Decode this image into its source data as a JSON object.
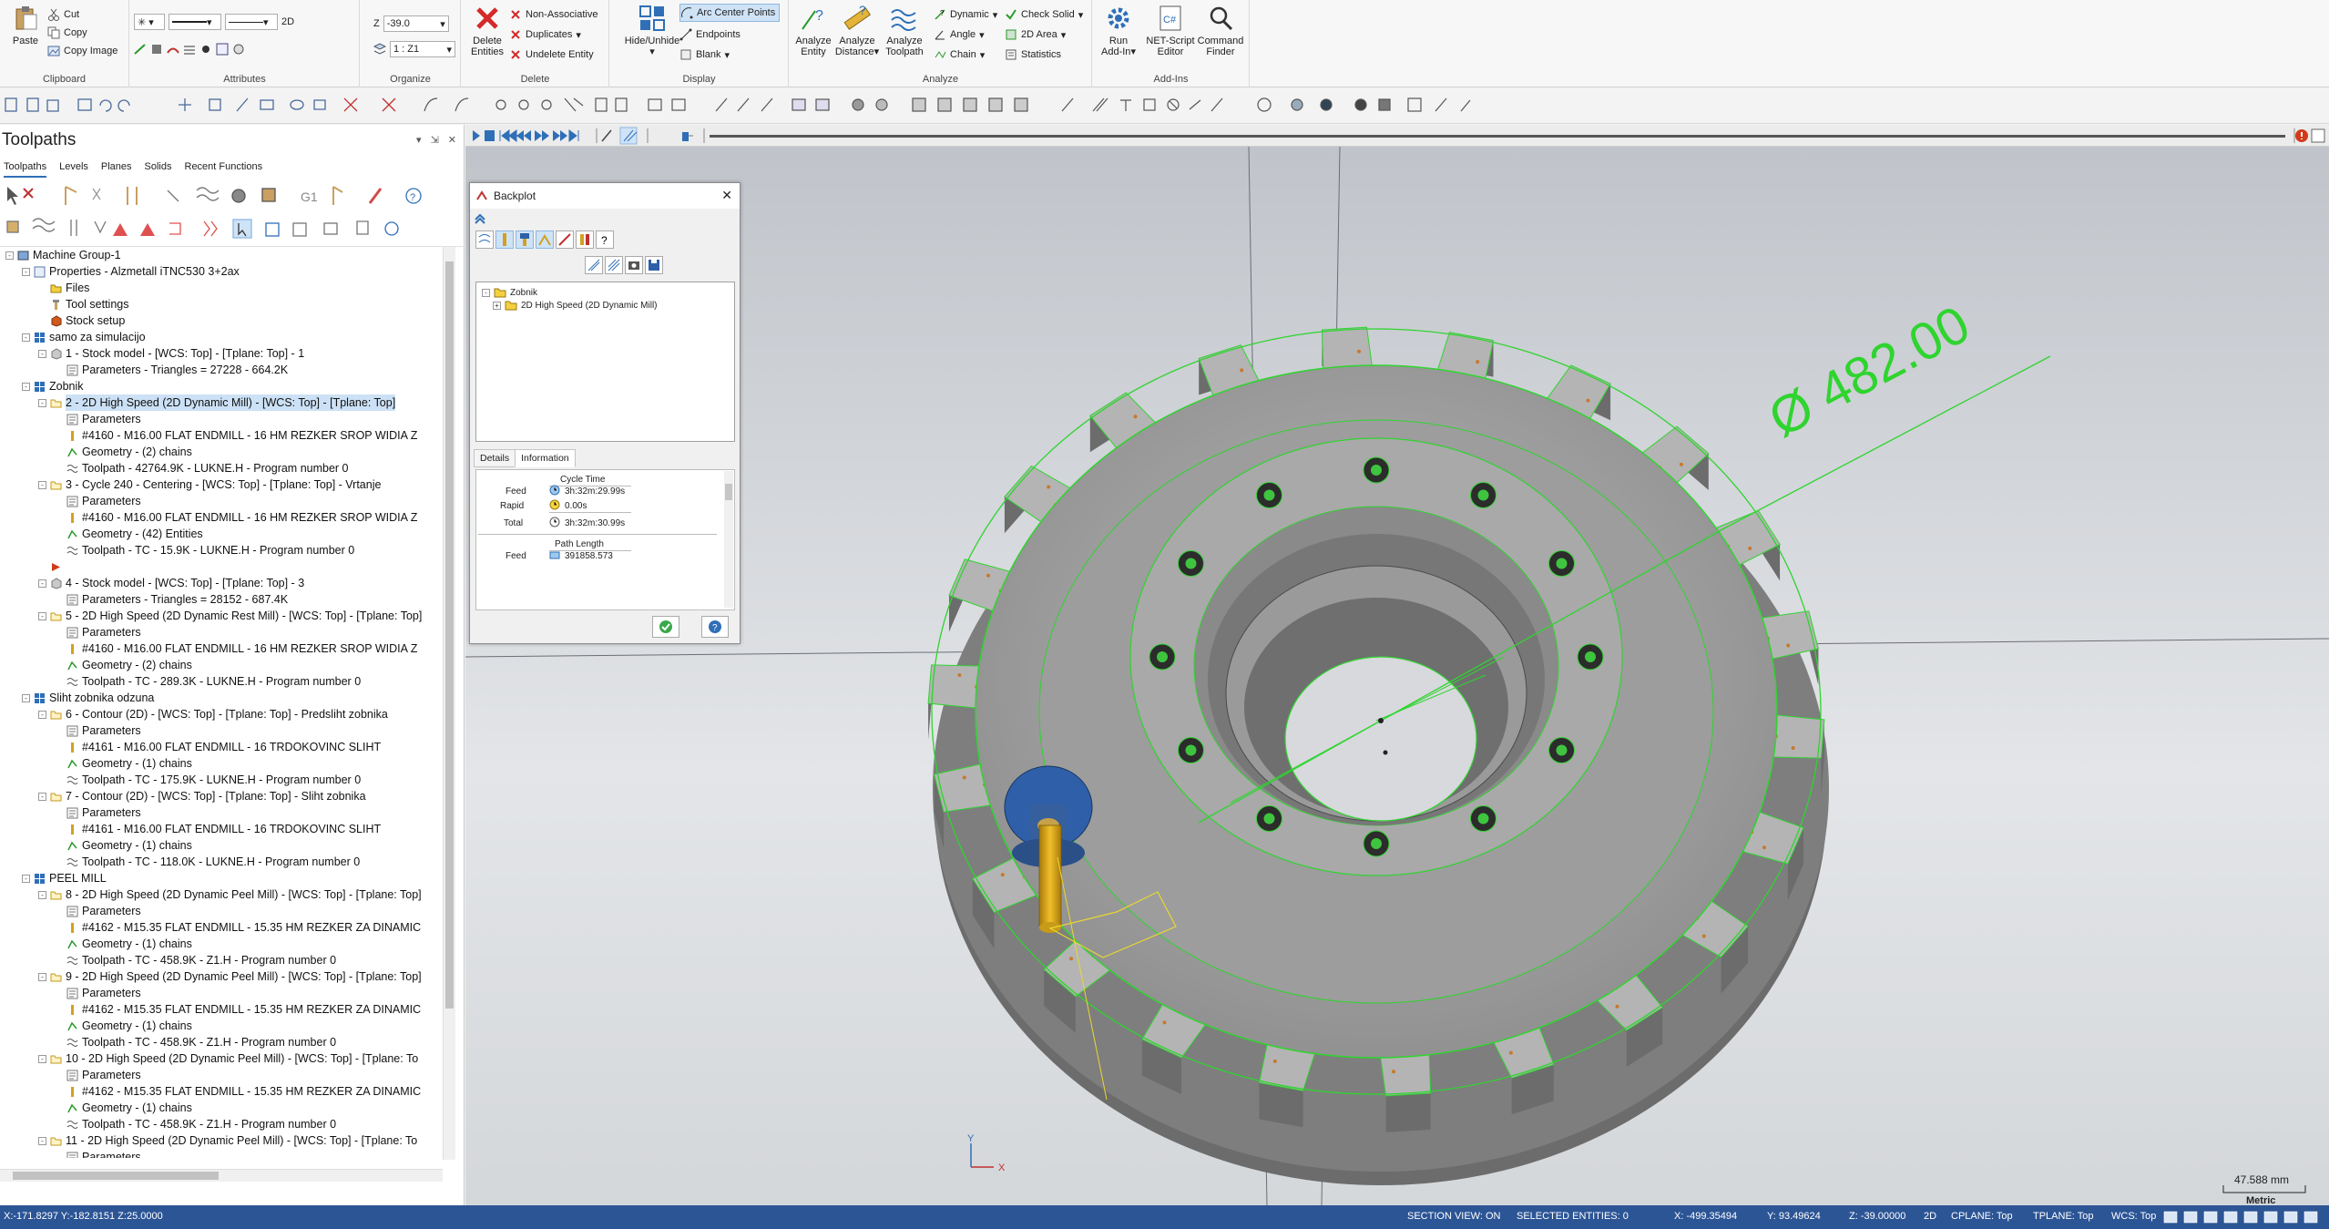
{
  "ribbon": {
    "clipboard": {
      "paste": "Paste",
      "cut": "Cut",
      "copy": "Copy",
      "copy_image": "Copy Image",
      "label": "Clipboard"
    },
    "attributes": {
      "mode": "2D",
      "label": "Attributes"
    },
    "organize": {
      "z_label": "Z",
      "z_value": "-39.0",
      "level_value": "1 : Z1",
      "label": "Organize"
    },
    "delete": {
      "delete_entities": "Delete\nEntities",
      "non_associative": "Non-Associative",
      "duplicates": "Duplicates",
      "undelete_entity": "Undelete Entity",
      "label": "Delete"
    },
    "display": {
      "hide_unhide": "Hide/Unhide",
      "arc_center_points": "Arc Center Points",
      "endpoints": "Endpoints",
      "blank": "Blank",
      "label": "Display"
    },
    "analyze": {
      "analyze_entity": "Analyze\nEntity",
      "analyze_distance": "Analyze\nDistance",
      "analyze_toolpath": "Analyze\nToolpath",
      "dynamic": "Dynamic",
      "angle": "Angle",
      "chain": "Chain",
      "check_solid": "Check Solid",
      "area_2d": "2D Area",
      "statistics": "Statistics",
      "label": "Analyze"
    },
    "addins": {
      "run_addin": "Run\nAdd-In",
      "net_script_editor": "NET-Script\nEditor",
      "command_finder": "Command\nFinder",
      "label": "Add-Ins"
    }
  },
  "left_panel": {
    "title": "Toolpaths",
    "controls": [
      "▾",
      "⇲",
      "✕"
    ],
    "tabs": [
      "Toolpaths",
      "Levels",
      "Planes",
      "Solids",
      "Recent Functions"
    ],
    "tree": [
      {
        "text": "Machine Group-1",
        "indent": 0,
        "icon": "machine-icon",
        "exp": "-"
      },
      {
        "text": "Properties - Alzmetall  iTNC530 3+2ax",
        "indent": 1,
        "icon": "properties-icon",
        "exp": "-"
      },
      {
        "text": "Files",
        "indent": 2,
        "icon": "folder-icon"
      },
      {
        "text": "Tool settings",
        "indent": 2,
        "icon": "tool-settings-icon"
      },
      {
        "text": "Stock setup",
        "indent": 2,
        "icon": "stock-icon"
      },
      {
        "text": "samo za simulacijo",
        "indent": 1,
        "icon": "group-icon",
        "exp": "-"
      },
      {
        "text": "1 - Stock model - [WCS: Top] - [Tplane: Top] - 1",
        "indent": 2,
        "icon": "stock-model-icon",
        "exp": "-"
      },
      {
        "text": "Parameters - Triangles = 27228 - 664.2K",
        "indent": 3,
        "icon": "parameters-icon"
      },
      {
        "text": "Zobnik",
        "indent": 1,
        "icon": "group-icon",
        "exp": "-"
      },
      {
        "text": "2 - 2D High Speed (2D Dynamic Mill) - [WCS: Top] - [Tplane: Top]",
        "indent": 2,
        "icon": "operation-folder-icon",
        "exp": "-",
        "selected": true
      },
      {
        "text": "Parameters",
        "indent": 3,
        "icon": "parameters-icon"
      },
      {
        "text": "#4160 - M16.00 FLAT ENDMILL - 16 HM REZKER SROP WIDIA Z",
        "indent": 3,
        "icon": "tool-icon"
      },
      {
        "text": "Geometry - (2) chains",
        "indent": 3,
        "icon": "geometry-icon"
      },
      {
        "text": "Toolpath - 42764.9K - LUKNE.H - Program number 0",
        "indent": 3,
        "icon": "toolpath-icon"
      },
      {
        "text": "3 - Cycle 240 - Centering - [WCS: Top] - [Tplane: Top] - Vrtanje",
        "indent": 2,
        "icon": "operation-folder-icon",
        "exp": "-"
      },
      {
        "text": "Parameters",
        "indent": 3,
        "icon": "parameters-icon"
      },
      {
        "text": "#4160 - M16.00 FLAT ENDMILL - 16 HM REZKER SROP WIDIA Z",
        "indent": 3,
        "icon": "tool-icon"
      },
      {
        "text": "Geometry - (42) Entities",
        "indent": 3,
        "icon": "geometry-icon"
      },
      {
        "text": "Toolpath - TC - 15.9K - LUKNE.H - Program number 0",
        "indent": 3,
        "icon": "toolpath-icon"
      },
      {
        "text": "",
        "indent": 2,
        "icon": "insert-arrow-icon"
      },
      {
        "text": "4 - Stock model - [WCS: Top] - [Tplane: Top] - 3",
        "indent": 2,
        "icon": "stock-model-icon",
        "exp": "-"
      },
      {
        "text": "Parameters - Triangles = 28152 - 687.4K",
        "indent": 3,
        "icon": "parameters-icon"
      },
      {
        "text": "5 - 2D High Speed (2D Dynamic Rest Mill) - [WCS: Top] - [Tplane: Top]",
        "indent": 2,
        "icon": "operation-folder-icon",
        "exp": "-"
      },
      {
        "text": "Parameters",
        "indent": 3,
        "icon": "parameters-icon"
      },
      {
        "text": "#4160 - M16.00 FLAT ENDMILL - 16 HM REZKER SROP WIDIA Z",
        "indent": 3,
        "icon": "tool-icon"
      },
      {
        "text": "Geometry - (2) chains",
        "indent": 3,
        "icon": "geometry-icon"
      },
      {
        "text": "Toolpath - TC - 289.3K - LUKNE.H - Program number 0",
        "indent": 3,
        "icon": "toolpath-icon"
      },
      {
        "text": "Sliht zobnika odzuna",
        "indent": 1,
        "icon": "group-icon",
        "exp": "-"
      },
      {
        "text": "6 - Contour (2D) - [WCS: Top] - [Tplane: Top] - Predsliht zobnika",
        "indent": 2,
        "icon": "operation-folder-icon",
        "exp": "-"
      },
      {
        "text": "Parameters",
        "indent": 3,
        "icon": "parameters-icon"
      },
      {
        "text": "#4161 - M16.00 FLAT ENDMILL - 16 TRDOKOVINC SLIHT",
        "indent": 3,
        "icon": "tool-icon"
      },
      {
        "text": "Geometry - (1) chains",
        "indent": 3,
        "icon": "geometry-icon"
      },
      {
        "text": "Toolpath - TC - 175.9K - LUKNE.H - Program number 0",
        "indent": 3,
        "icon": "toolpath-icon"
      },
      {
        "text": "7 - Contour (2D) - [WCS: Top] - [Tplane: Top] - Sliht zobnika",
        "indent": 2,
        "icon": "operation-folder-icon",
        "exp": "-"
      },
      {
        "text": "Parameters",
        "indent": 3,
        "icon": "parameters-icon"
      },
      {
        "text": "#4161 - M16.00 FLAT ENDMILL - 16 TRDOKOVINC SLIHT",
        "indent": 3,
        "icon": "tool-icon"
      },
      {
        "text": "Geometry - (1) chains",
        "indent": 3,
        "icon": "geometry-icon"
      },
      {
        "text": "Toolpath - TC - 118.0K - LUKNE.H - Program number 0",
        "indent": 3,
        "icon": "toolpath-icon"
      },
      {
        "text": "PEEL MILL",
        "indent": 1,
        "icon": "group-icon",
        "exp": "-"
      },
      {
        "text": "8 - 2D High Speed (2D Dynamic Peel Mill) - [WCS: Top] - [Tplane: Top]",
        "indent": 2,
        "icon": "operation-folder-icon",
        "exp": "-"
      },
      {
        "text": "Parameters",
        "indent": 3,
        "icon": "parameters-icon"
      },
      {
        "text": "#4162 - M15.35 FLAT ENDMILL - 15.35 HM REZKER ZA DINAMIC",
        "indent": 3,
        "icon": "tool-icon"
      },
      {
        "text": "Geometry - (1) chains",
        "indent": 3,
        "icon": "geometry-icon"
      },
      {
        "text": "Toolpath - TC - 458.9K - Z1.H - Program number 0",
        "indent": 3,
        "icon": "toolpath-icon"
      },
      {
        "text": "9 - 2D High Speed (2D Dynamic Peel Mill) - [WCS: Top] - [Tplane: Top]",
        "indent": 2,
        "icon": "operation-folder-icon",
        "exp": "-"
      },
      {
        "text": "Parameters",
        "indent": 3,
        "icon": "parameters-icon"
      },
      {
        "text": "#4162 - M15.35 FLAT ENDMILL - 15.35 HM REZKER ZA DINAMIC",
        "indent": 3,
        "icon": "tool-icon"
      },
      {
        "text": "Geometry - (1) chains",
        "indent": 3,
        "icon": "geometry-icon"
      },
      {
        "text": "Toolpath - TC - 458.9K - Z1.H - Program number 0",
        "indent": 3,
        "icon": "toolpath-icon"
      },
      {
        "text": "10 - 2D High Speed (2D Dynamic Peel Mill) - [WCS: Top] - [Tplane: To",
        "indent": 2,
        "icon": "operation-folder-icon",
        "exp": "-"
      },
      {
        "text": "Parameters",
        "indent": 3,
        "icon": "parameters-icon"
      },
      {
        "text": "#4162 - M15.35 FLAT ENDMILL - 15.35 HM REZKER ZA DINAMIC",
        "indent": 3,
        "icon": "tool-icon"
      },
      {
        "text": "Geometry - (1) chains",
        "indent": 3,
        "icon": "geometry-icon"
      },
      {
        "text": "Toolpath - TC - 458.9K - Z1.H - Program number 0",
        "indent": 3,
        "icon": "toolpath-icon"
      },
      {
        "text": "11 - 2D High Speed (2D Dynamic Peel Mill) - [WCS: Top] - [Tplane: To",
        "indent": 2,
        "icon": "operation-folder-icon",
        "exp": "-"
      },
      {
        "text": "Parameters",
        "indent": 3,
        "icon": "parameters-icon"
      }
    ]
  },
  "backplot": {
    "title": "Backplot",
    "tree_root": "Zobnik",
    "tree_child": "2D High Speed (2D Dynamic Mill)",
    "tabs": [
      "Details",
      "Information"
    ],
    "cycle_time_header": "Cycle Time",
    "feed_label": "Feed",
    "feed_value": "3h:32m:29.99s",
    "rapid_label": "Rapid",
    "rapid_value": "0.00s",
    "total_label": "Total",
    "total_value": "3h:32m:30.99s",
    "path_length_header": "Path Length",
    "path_feed_label": "Feed",
    "path_feed_value": "391858.573"
  },
  "viewport": {
    "dimension_label": "Ø  482.00",
    "scale_value": "47.588 mm",
    "scale_unit": "Metric",
    "axis_x": "X",
    "axis_y": "Y"
  },
  "statusbar": {
    "coords": "X:-171.8297   Y:-182.8151   Z:25.0000",
    "section_view": "SECTION VIEW: ON",
    "selected": "SELECTED ENTITIES: 0",
    "x": "X:   -499.35494",
    "y": "Y:   93.49624",
    "z": "Z:   -39.00000",
    "mode": "2D",
    "cplane": "CPLANE: Top",
    "tplane": "TPLANE: Top",
    "wcs": "WCS: Top"
  },
  "colors": {
    "accent": "#2f6fb7",
    "status_bar": "#2c5596",
    "selection_green": "#2fd42f",
    "part_gray": "#9a9a9a"
  }
}
